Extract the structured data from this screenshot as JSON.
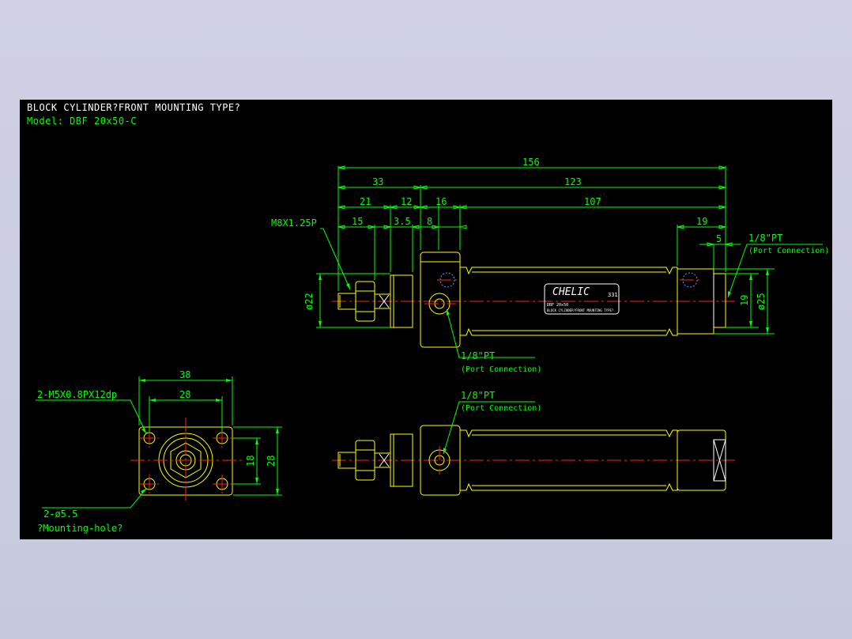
{
  "title": "BLOCK CYLINDER?FRONT MOUNTING TYPE?",
  "model": "Model: DBF 20x50-C",
  "side_view": {
    "dims": {
      "overall": "156",
      "d33": "33",
      "d123": "123",
      "d21": "21",
      "d12": "12",
      "d16": "16",
      "d107": "107",
      "d15": "15",
      "d3_5": "3.5",
      "d8": "8",
      "d19_top": "19",
      "d5": "5",
      "dia22": "ø22",
      "dia19": "19",
      "dia25": "ø25"
    },
    "thread": "M8X1.25P",
    "port_label": "1/8\"PT",
    "port_sub": "(Port Connection)",
    "brand": "CHELIC",
    "brand_code": "331",
    "nameplate_line1": "DBF 20x50",
    "nameplate_line2": "BLOCK CYLINDER?FRONT MOUNTING TYPE?"
  },
  "end_view": {
    "width": "38",
    "hole_pitch_x": "28",
    "hole_pitch_y": "18",
    "height": "28",
    "tapped_holes": "2-M5X0.8PX12dp",
    "mount_holes": "2-ø5.5",
    "mount_holes_sub": "?Mounting-hole?"
  },
  "bottom_view": {
    "port_label": "1/8\"PT",
    "port_sub": "(Port Connection)"
  },
  "colors": {
    "background": "#000000",
    "outline": "#ffff00",
    "dimension": "#00ff00",
    "centerline": "#ff2020",
    "title": "#ffffff"
  }
}
